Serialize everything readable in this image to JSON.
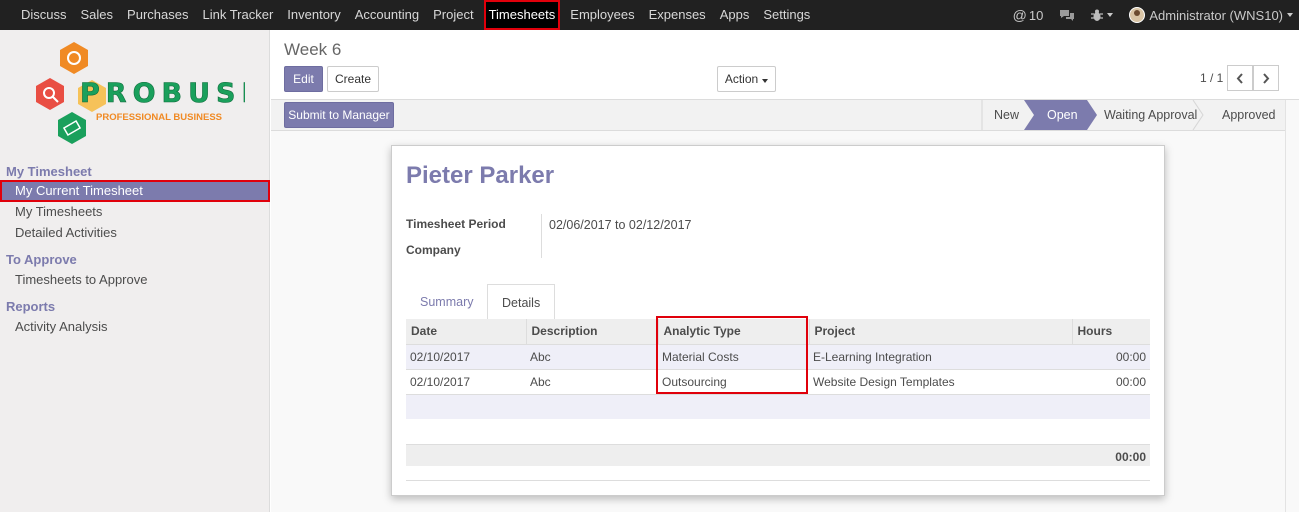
{
  "topnav": {
    "menu": [
      "Discuss",
      "Sales",
      "Purchases",
      "Link Tracker",
      "Inventory",
      "Accounting",
      "Project",
      "Timesheets",
      "Employees",
      "Expenses",
      "Apps",
      "Settings"
    ],
    "active": "Timesheets",
    "mentions_count": "10",
    "user_label": "Administrator (WNS10)"
  },
  "logo": {
    "brand": "PROBUSE",
    "tagline": "PROFESSIONAL BUSINESS"
  },
  "sidebar": {
    "sections": [
      {
        "title": "My Timesheet",
        "items": [
          "My Current Timesheet",
          "My Timesheets",
          "Detailed Activities"
        ]
      },
      {
        "title": "To Approve",
        "items": [
          "Timesheets to Approve"
        ]
      },
      {
        "title": "Reports",
        "items": [
          "Activity Analysis"
        ]
      }
    ],
    "active_item": "My Current Timesheet"
  },
  "control_panel": {
    "breadcrumb": "Week 6",
    "edit_label": "Edit",
    "create_label": "Create",
    "action_label": "Action",
    "pager": "1 / 1"
  },
  "statusbar": {
    "submit_label": "Submit to Manager",
    "stages": [
      "New",
      "Open",
      "Waiting Approval",
      "Approved"
    ],
    "current_stage": "Open"
  },
  "form": {
    "employee_name": "Pieter Parker",
    "period_label": "Timesheet Period",
    "period_value": "02/06/2017 to 02/12/2017",
    "company_label": "Company",
    "company_value": "",
    "tabs": [
      "Summary",
      "Details"
    ],
    "active_tab": "Details",
    "table": {
      "columns": [
        "Date",
        "Description",
        "Analytic Type",
        "Project",
        "Hours"
      ],
      "rows": [
        [
          "02/10/2017",
          "Abc",
          "Material Costs",
          "E-Learning Integration",
          "00:00"
        ],
        [
          "02/10/2017",
          "Abc",
          "Outsourcing",
          "Website Design Templates",
          "00:00"
        ]
      ],
      "total": "00:00"
    }
  },
  "colors": {
    "accent": "#7c7bad",
    "highlight": "#e0000b",
    "topbar": "#212121"
  }
}
